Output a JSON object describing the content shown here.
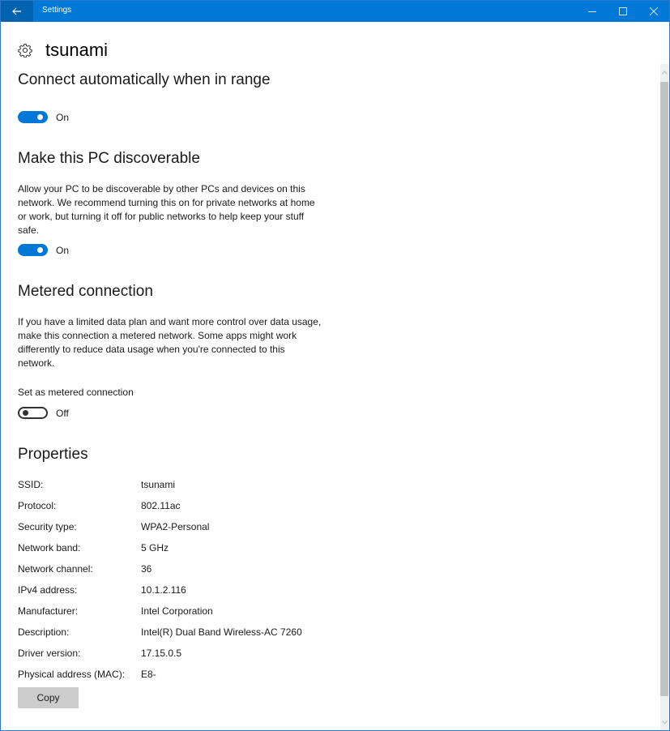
{
  "window": {
    "title": "Settings",
    "controls": [
      "minimize",
      "maximize",
      "close"
    ]
  },
  "page": {
    "icon": "gear-icon",
    "title": "tsunami"
  },
  "connect_auto": {
    "heading": "Connect automatically when in range",
    "toggle_state": "On",
    "enabled": true
  },
  "discoverable": {
    "heading": "Make this PC discoverable",
    "description": "Allow your PC to be discoverable by other PCs and devices on this network. We recommend turning this on for private networks at home or work, but turning it off for public networks to help keep your stuff safe.",
    "toggle_state": "On",
    "enabled": true
  },
  "metered": {
    "heading": "Metered connection",
    "description": "If you have a limited data plan and want more control over data usage, make this connection a metered network. Some apps might work differently to reduce data usage when you're connected to this network.",
    "setting_label": "Set as metered connection",
    "toggle_state": "Off",
    "enabled": false
  },
  "properties": {
    "heading": "Properties",
    "rows": [
      {
        "key": "SSID:",
        "value": "tsunami"
      },
      {
        "key": "Protocol:",
        "value": "802.11ac"
      },
      {
        "key": "Security type:",
        "value": "WPA2-Personal"
      },
      {
        "key": "Network band:",
        "value": "5 GHz"
      },
      {
        "key": "Network channel:",
        "value": "36"
      },
      {
        "key": "IPv4 address:",
        "value": "10.1.2.116"
      },
      {
        "key": "Manufacturer:",
        "value": "Intel Corporation"
      },
      {
        "key": "Description:",
        "value": "Intel(R) Dual Band Wireless-AC 7260"
      },
      {
        "key": "Driver version:",
        "value": "17.15.0.5"
      },
      {
        "key": "Physical address (MAC):",
        "value": "E8-"
      }
    ],
    "copy_label": "Copy"
  },
  "colors": {
    "accent": "#0078d7",
    "back_button": "#0063b1",
    "button_gray": "#cccccc"
  }
}
